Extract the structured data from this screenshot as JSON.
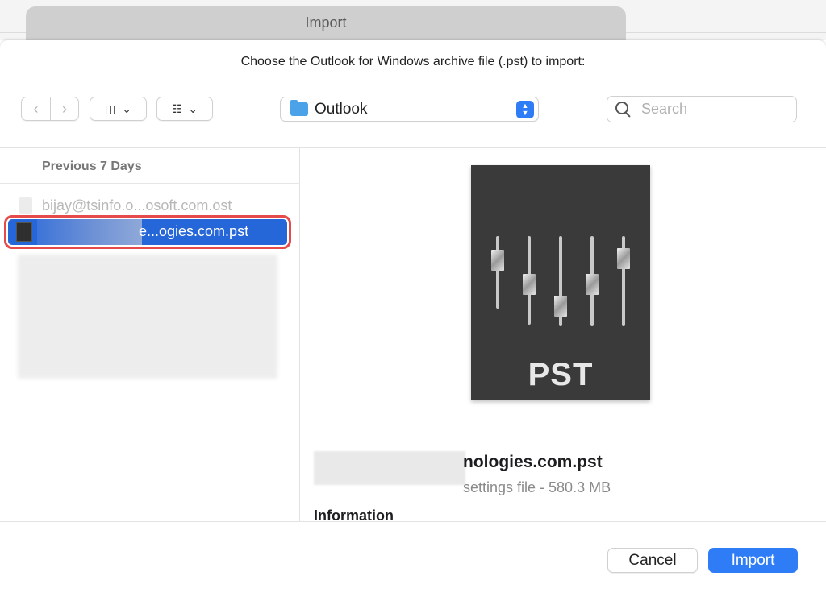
{
  "background_window": {
    "partial_text": ""
  },
  "dialog": {
    "title": "Import",
    "prompt": "Choose the Outlook for Windows archive file (.pst) to import:"
  },
  "toolbar": {
    "back_icon": "chevron-left-icon",
    "forward_icon": "chevron-right-icon",
    "view_icon": "column-view-icon",
    "group_icon": "grid-icon",
    "location": "Outlook",
    "search_placeholder": "Search"
  },
  "file_list": {
    "section": "Previous 7 Days",
    "items": [
      {
        "label": "bijay@tsinfo.o...osoft.com.ost",
        "enabled": false
      },
      {
        "label": "e...ogies.com.pst",
        "selected": true
      }
    ]
  },
  "preview": {
    "icon_label": "PST",
    "filename": "nologies.com.pst",
    "kind": "settings file - 580.3 MB",
    "info_heading": "Information"
  },
  "buttons": {
    "cancel": "Cancel",
    "import": "Import"
  },
  "colors": {
    "accent": "#2f7df6",
    "selection": "#2566d8",
    "highlight_outline": "#e54b4b"
  }
}
